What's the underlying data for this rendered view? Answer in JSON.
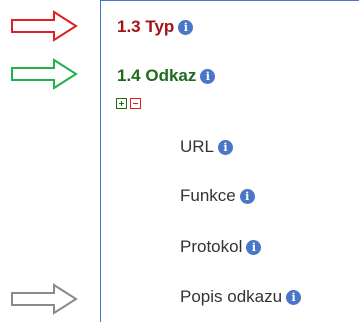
{
  "sections": [
    {
      "title": "1.3 Typ",
      "color": "#a31515",
      "arrow_color": "#e02020"
    },
    {
      "title": "1.4 Odkaz",
      "color": "#1e6b1e",
      "arrow_color": "#22b04a"
    }
  ],
  "tree_controls": {
    "expand_icon": "plus-square-icon",
    "collapse_icon": "minus-square-icon",
    "expand_color": "#1e6b1e",
    "collapse_color": "#e02020"
  },
  "fields": [
    {
      "label": "URL"
    },
    {
      "label": "Funkce"
    },
    {
      "label": "Protokol"
    },
    {
      "label": "Popis odkazu"
    }
  ],
  "info_icon": {
    "glyph": "i",
    "color": "#4a76c8"
  },
  "pointer_arrow_color": "#8a8a8a",
  "text_color": "#333333"
}
